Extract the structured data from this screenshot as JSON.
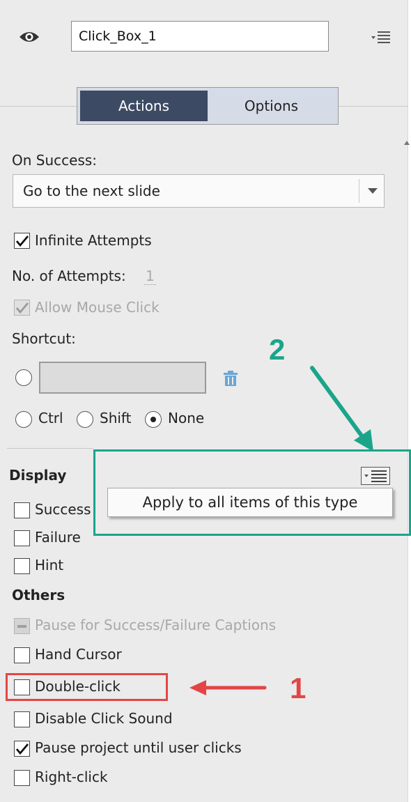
{
  "header": {
    "visibility_icon": "eye-icon",
    "object_name": "Click_Box_1",
    "panel_menu_icon": "options-menu-icon"
  },
  "tabs": [
    {
      "label": "Actions",
      "active": true
    },
    {
      "label": "Options",
      "active": false
    }
  ],
  "actions": {
    "on_success_label": "On Success:",
    "on_success_value": "Go to the next slide",
    "infinite_attempts": {
      "label": "Infinite Attempts",
      "checked": true
    },
    "attempts_label": "No. of Attempts:",
    "attempts_value": "1",
    "allow_mouse_click": {
      "label": "Allow Mouse Click",
      "checked": true,
      "disabled": true
    },
    "shortcut_label": "Shortcut:",
    "shortcut_value": "",
    "delete_icon": "trash-icon",
    "modifiers": [
      {
        "label": "Ctrl",
        "selected": false
      },
      {
        "label": "Shift",
        "selected": false
      },
      {
        "label": "None",
        "selected": true
      }
    ]
  },
  "display": {
    "heading": "Display",
    "menu_icon": "options-menu-icon",
    "items": [
      {
        "label": "Success",
        "checked": false
      },
      {
        "label": "Failure",
        "checked": false
      },
      {
        "label": "Hint",
        "checked": false
      }
    ]
  },
  "context_menu": {
    "apply_label": "Apply to all items of this type"
  },
  "others": {
    "heading": "Others",
    "items": [
      {
        "label": "Pause for Success/Failure Captions",
        "checked": false,
        "disabled": true
      },
      {
        "label": "Hand Cursor",
        "checked": false
      },
      {
        "label": "Double-click",
        "checked": false
      },
      {
        "label": "Disable Click Sound",
        "checked": false
      },
      {
        "label": "Pause project until user clicks",
        "checked": true
      },
      {
        "label": "Right-click",
        "checked": false
      }
    ]
  },
  "annotations": {
    "callout_1": "1",
    "callout_2": "2",
    "teal_color": "#1aa58b",
    "red_color": "#e34545"
  }
}
